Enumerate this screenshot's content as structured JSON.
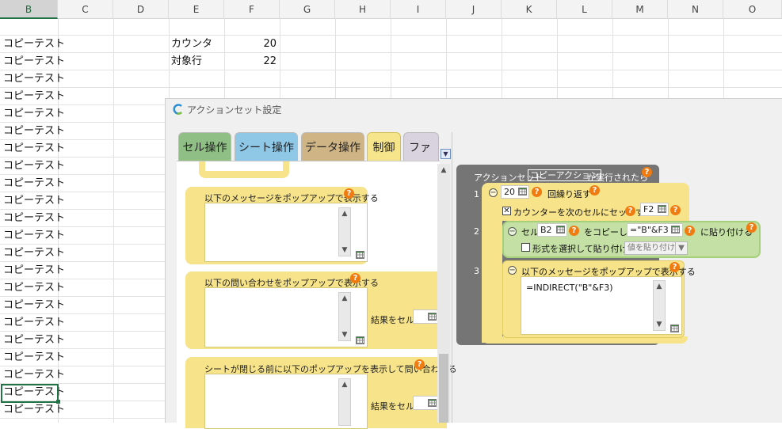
{
  "spreadsheet": {
    "columns": [
      "B",
      "C",
      "D",
      "E",
      "F",
      "G",
      "H",
      "I",
      "J",
      "K",
      "L",
      "M",
      "N",
      "O"
    ],
    "selected_column": "B",
    "b_cells": [
      "コピーテスト",
      "コピーテスト",
      "コピーテスト",
      "コピーテスト",
      "コピーテスト",
      "コピーテスト",
      "コピーテスト",
      "コピーテスト",
      "コピーテスト",
      "コピーテスト",
      "コピーテスト",
      "コピーテスト",
      "コピーテスト",
      "コピーテスト",
      "コピーテスト",
      "コピーテスト",
      "コピーテスト",
      "コピーテスト",
      "コピーテスト",
      "コピーテスト",
      "コピーテスト",
      "コピーテスト"
    ],
    "e_cells": [
      "カウンタ",
      "対象行"
    ],
    "f_cells": [
      "20",
      "22"
    ]
  },
  "dialog": {
    "title": "アクションセット設定",
    "tabs": [
      "セル操作",
      "シート操作",
      "データ操作",
      "制御",
      "ファイル"
    ],
    "active_tab": "制御",
    "tab_colors": [
      "#8fbf85",
      "#8fc7e6",
      "#cfb486",
      "#f7e58c",
      "#d9d3df"
    ],
    "palette": {
      "block1_title": "以下のメッセージをポップアップで表示する",
      "block2_title": "以下の問い合わせをポップアップで表示する",
      "block2_result_label": "結果をセル",
      "block3_title": "シートが閉じる前に以下のポップアップを表示して問い合わせる",
      "block3_result_label": "結果をセル"
    },
    "script": {
      "header_prefix": "アクションセット",
      "action_name": "コピーアクション",
      "header_suffix": "が実行されたら",
      "line_numbers": [
        "1",
        "2",
        "3"
      ],
      "loop_count": "20",
      "loop_label": "回繰り返す",
      "counter_label": "カウンターを次のセルにセットする",
      "counter_cell": "F2",
      "copy_cell_label": "セル",
      "copy_source": "B2",
      "copy_mid_label": "をコピーして",
      "copy_target": "=\"B\"&F3",
      "copy_end_label": "に貼り付ける",
      "paste_special_label": "形式を選択して貼り付け",
      "paste_option": "値を貼り付け",
      "message_label": "以下のメッセージをポップアップで表示する",
      "message_text": "=INDIRECT(\"B\"&F3)"
    },
    "colors": {
      "block_yellow": "#f6e38a",
      "block_green": "#c4e0a4",
      "help_orange": "#f07b10"
    }
  }
}
